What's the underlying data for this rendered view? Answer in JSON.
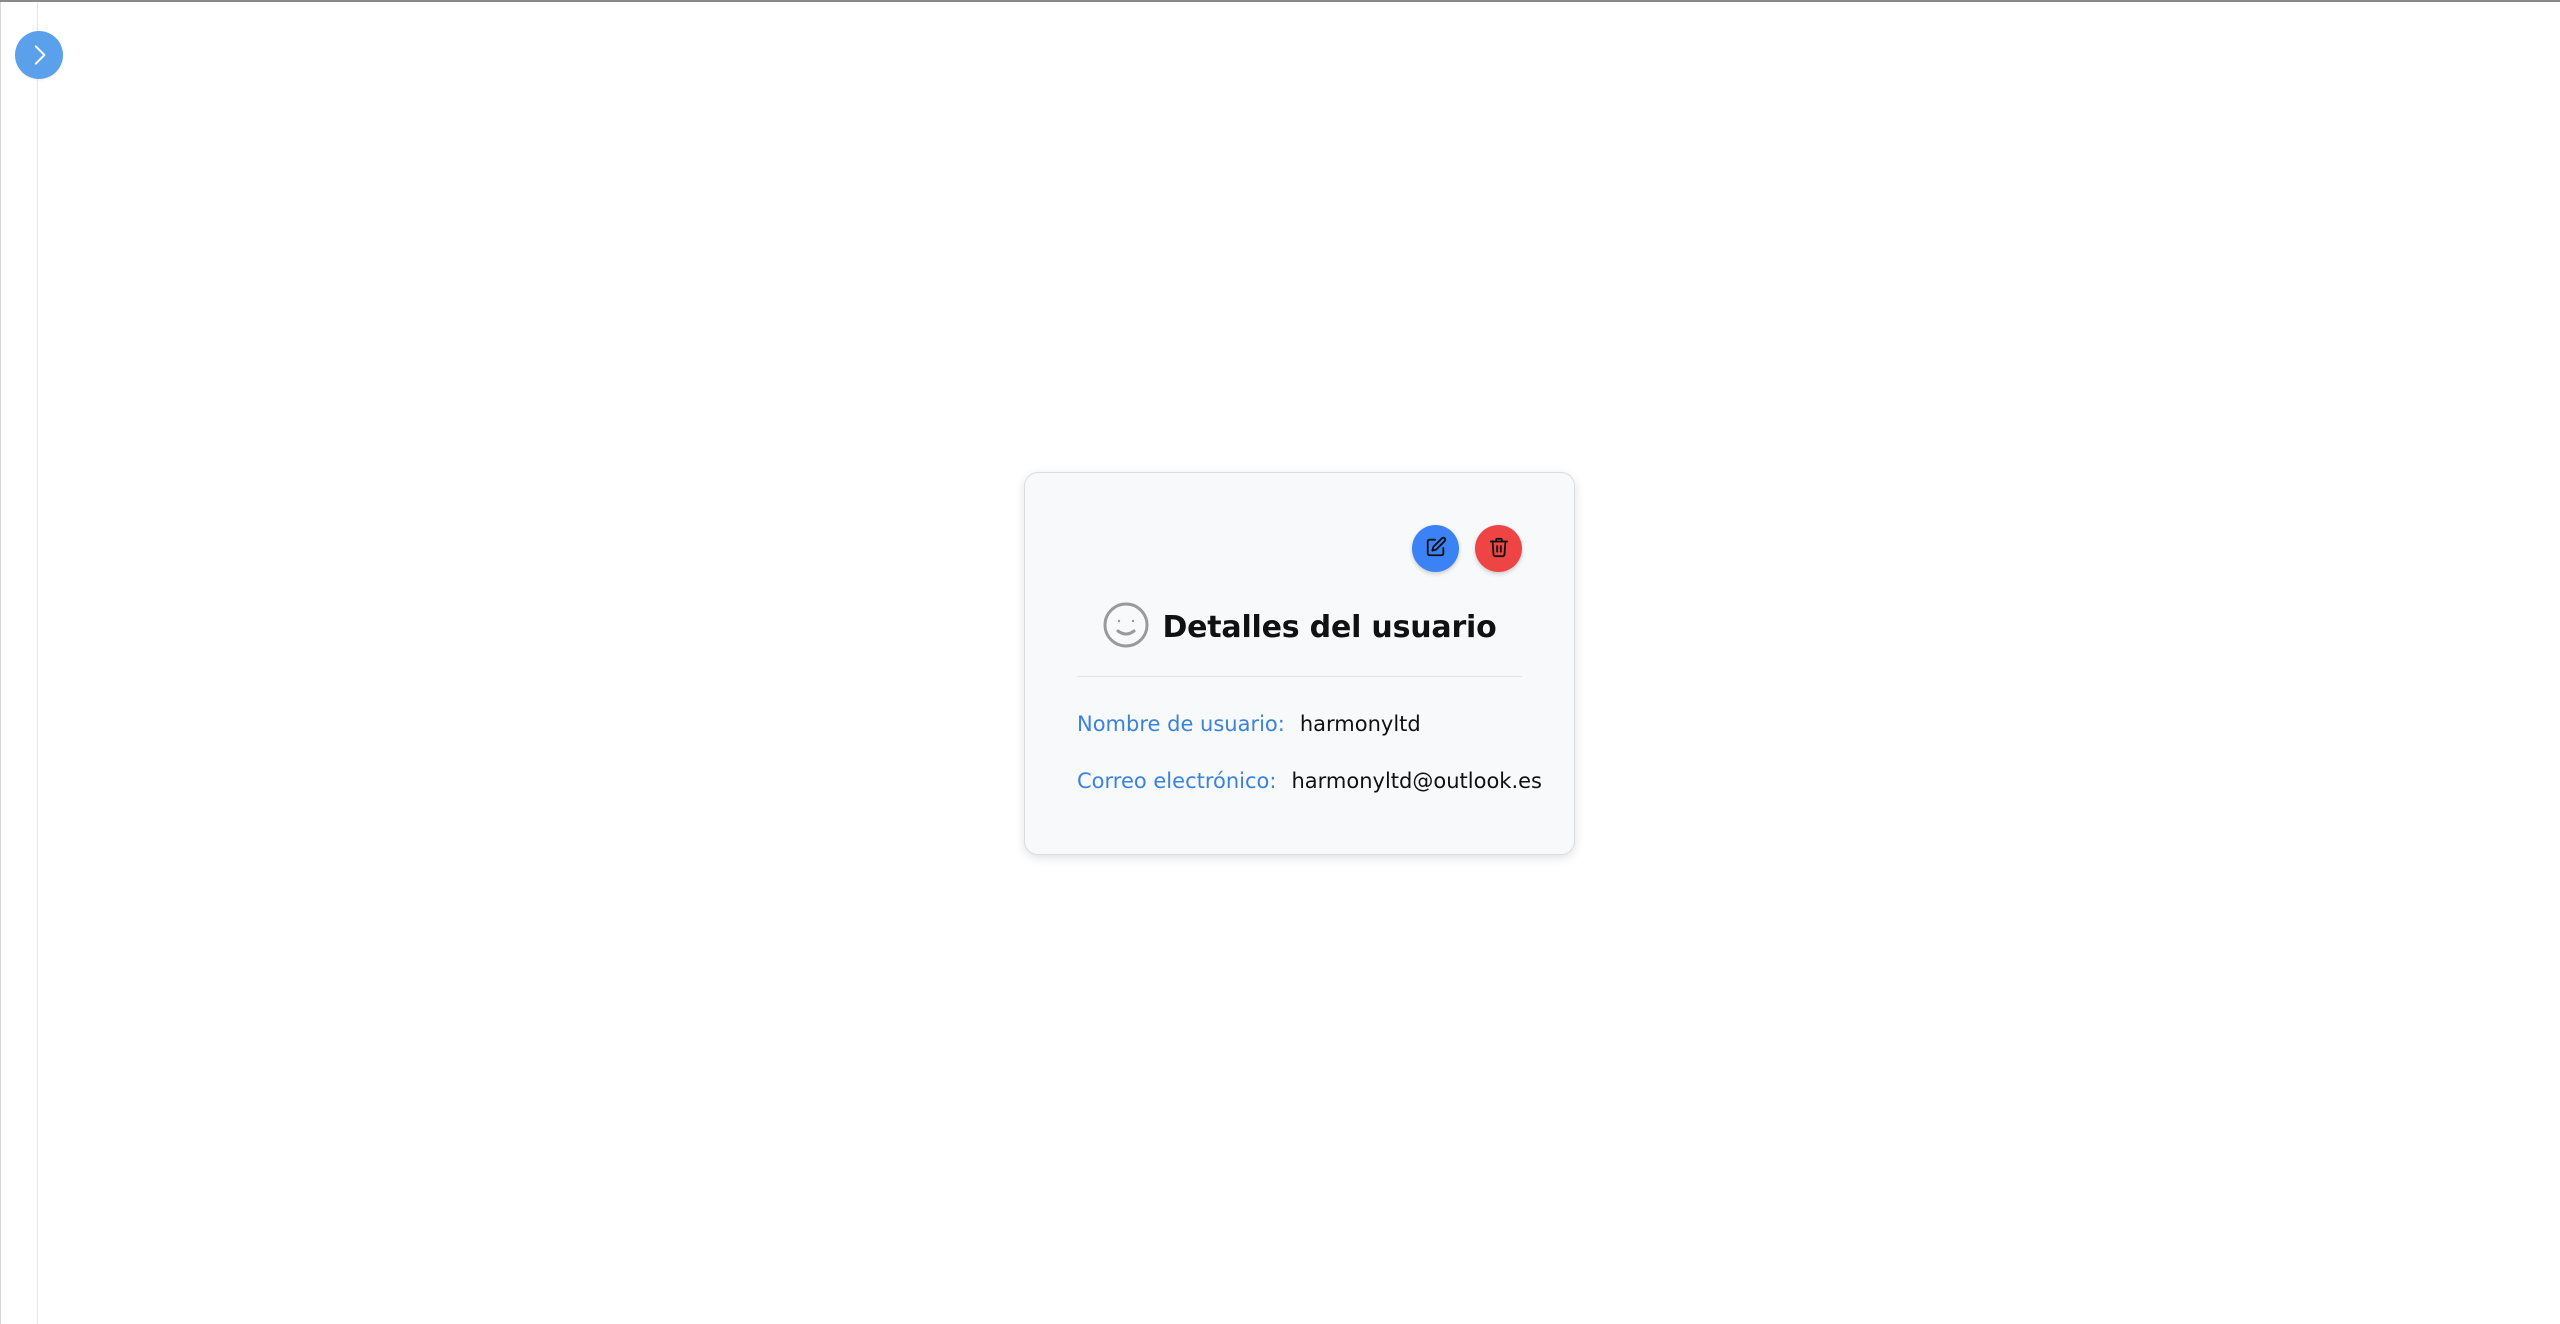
{
  "sidebar": {
    "toggle_icon": "chevron-right-icon",
    "toggle_color": "#5aa0ea"
  },
  "user_card": {
    "title": "Detalles del usuario",
    "title_icon": "smiley-face-icon",
    "edit_icon": "pencil-square-icon",
    "delete_icon": "trash-icon",
    "edit_color": "#3b82f6",
    "delete_color": "#ef4444",
    "fields": [
      {
        "label": "Nombre de usuario:",
        "value": "harmonyltd"
      },
      {
        "label": "Correo electrónico:",
        "value": "harmonyltd@outlook.es"
      }
    ]
  }
}
